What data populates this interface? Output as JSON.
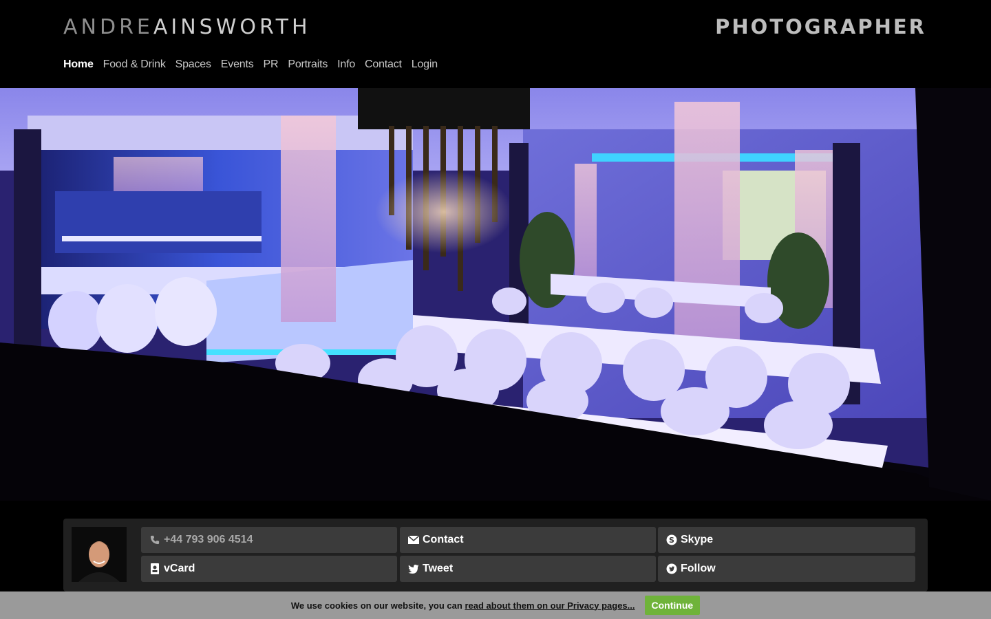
{
  "header": {
    "brand_first": "ANDRE",
    "brand_last": "AINSWORTH",
    "tagline": "PHOTOGRAPHER"
  },
  "nav": {
    "home": "Home",
    "food_drink": "Food & Drink",
    "spaces": "Spaces",
    "events": "Events",
    "pr": "PR",
    "portraits": "Portraits",
    "info": "Info",
    "contact": "Contact",
    "login": "Login"
  },
  "contact_bar": {
    "phone": "+44 793 906 4514",
    "contact": "Contact",
    "skype": "Skype",
    "vcard": "vCard",
    "tweet": "Tweet",
    "follow": "Follow"
  },
  "cookie": {
    "text": "We use cookies on our website, you can ",
    "link": "read about them on our Privacy pages...",
    "button": "Continue"
  },
  "colors": {
    "background": "#000000",
    "bar": "#202020",
    "button": "#3b3b3b",
    "accent_green": "#6fb33a"
  }
}
